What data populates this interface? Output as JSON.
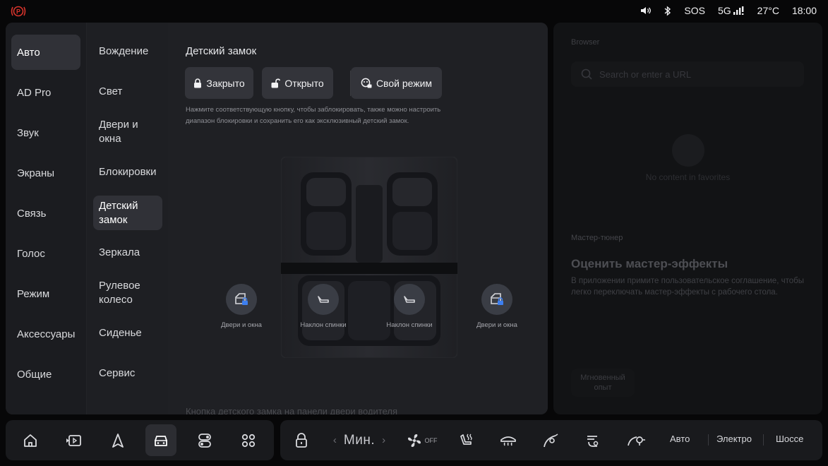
{
  "status": {
    "sos": "SOS",
    "network": "5G",
    "temperature": "27°C",
    "time": "18:00"
  },
  "nav_primary": [
    {
      "label": "Авто",
      "active": true
    },
    {
      "label": "AD Pro"
    },
    {
      "label": "Звук"
    },
    {
      "label": "Экраны"
    },
    {
      "label": "Связь"
    },
    {
      "label": "Голос"
    },
    {
      "label": "Режим"
    },
    {
      "label": "Аксессуары"
    },
    {
      "label": "Общие"
    }
  ],
  "nav_secondary": [
    {
      "label": "Вождение"
    },
    {
      "label": "Свет"
    },
    {
      "label": "Двери и окна"
    },
    {
      "label": "Блокировки"
    },
    {
      "label": "Детский замок",
      "active": true
    },
    {
      "label": "Зеркала"
    },
    {
      "label": "Рулевое колесо"
    },
    {
      "label": "Сиденье"
    },
    {
      "label": "Сервис"
    }
  ],
  "child_lock": {
    "title": "Детский замок",
    "buttons": {
      "closed": "Закрыто",
      "open": "Открыто",
      "custom": "Свой режим"
    },
    "description": "Нажмите соответствующую кнопку, чтобы заблокировать, также можно настроить диапазон блокировки и сохранить его как эксклюзивный детский замок.",
    "controls": {
      "left_doors": "Двери и окна",
      "left_recline": "Наклон спинки",
      "right_recline": "Наклон спинки",
      "right_doors": "Двери и окна"
    },
    "footer_faded": "Кнопка детского замка на панели двери водителя"
  },
  "widgets": {
    "browser_label": "Browser",
    "search_placeholder": "Search or enter a URL",
    "no_content": "No content in favorites",
    "master_label": "Мастер-тюнер",
    "master_title": "Оценить мастер-эффекты",
    "master_desc": "В приложении примите пользовательское соглашение, чтобы легко переключать мастер-эффекты с рабочего стола.",
    "instant_label": "Мгновенный опыт"
  },
  "dock": {
    "left_icons": [
      "home-icon",
      "media-icon",
      "navigation-icon",
      "vehicle-icon",
      "controls-icon",
      "apps-icon"
    ],
    "active_icon": "vehicle-icon",
    "fan_level": "Мин.",
    "ac_state": "OFF",
    "modes": [
      "Авто",
      "Электро",
      "Шоссе"
    ]
  },
  "colors": {
    "accent_blue": "#3d7ff0",
    "control_circle": "#3a3d45",
    "panel": "#1b1c20"
  }
}
